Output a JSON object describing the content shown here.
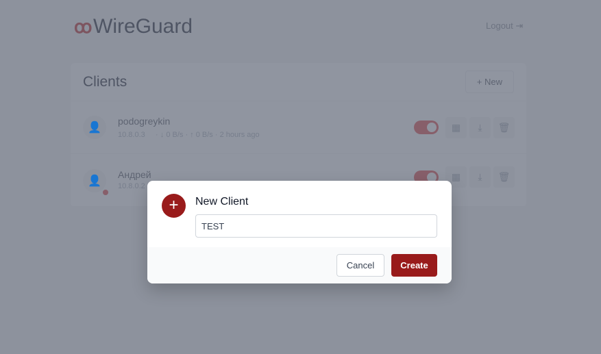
{
  "app": {
    "title": "WireGuard",
    "logout": "Logout ⇥"
  },
  "clients": {
    "title": "Clients",
    "new_label": "+  New",
    "items": [
      {
        "name": "podogreykin",
        "address": "10.8.0.3",
        "stats": "· ↓ 0 B/s · ↑ 0 B/s · 2 hours ago",
        "enabled": true,
        "status_dot": false
      },
      {
        "name": "Андрей",
        "address": "10.8.0.2",
        "stats": "",
        "enabled": true,
        "status_dot": true
      }
    ]
  },
  "modal": {
    "title": "New Client",
    "input_value": "TEST",
    "cancel": "Cancel",
    "create": "Create"
  },
  "colors": {
    "accent": "#991b1b",
    "toggle": "#dc2626"
  }
}
